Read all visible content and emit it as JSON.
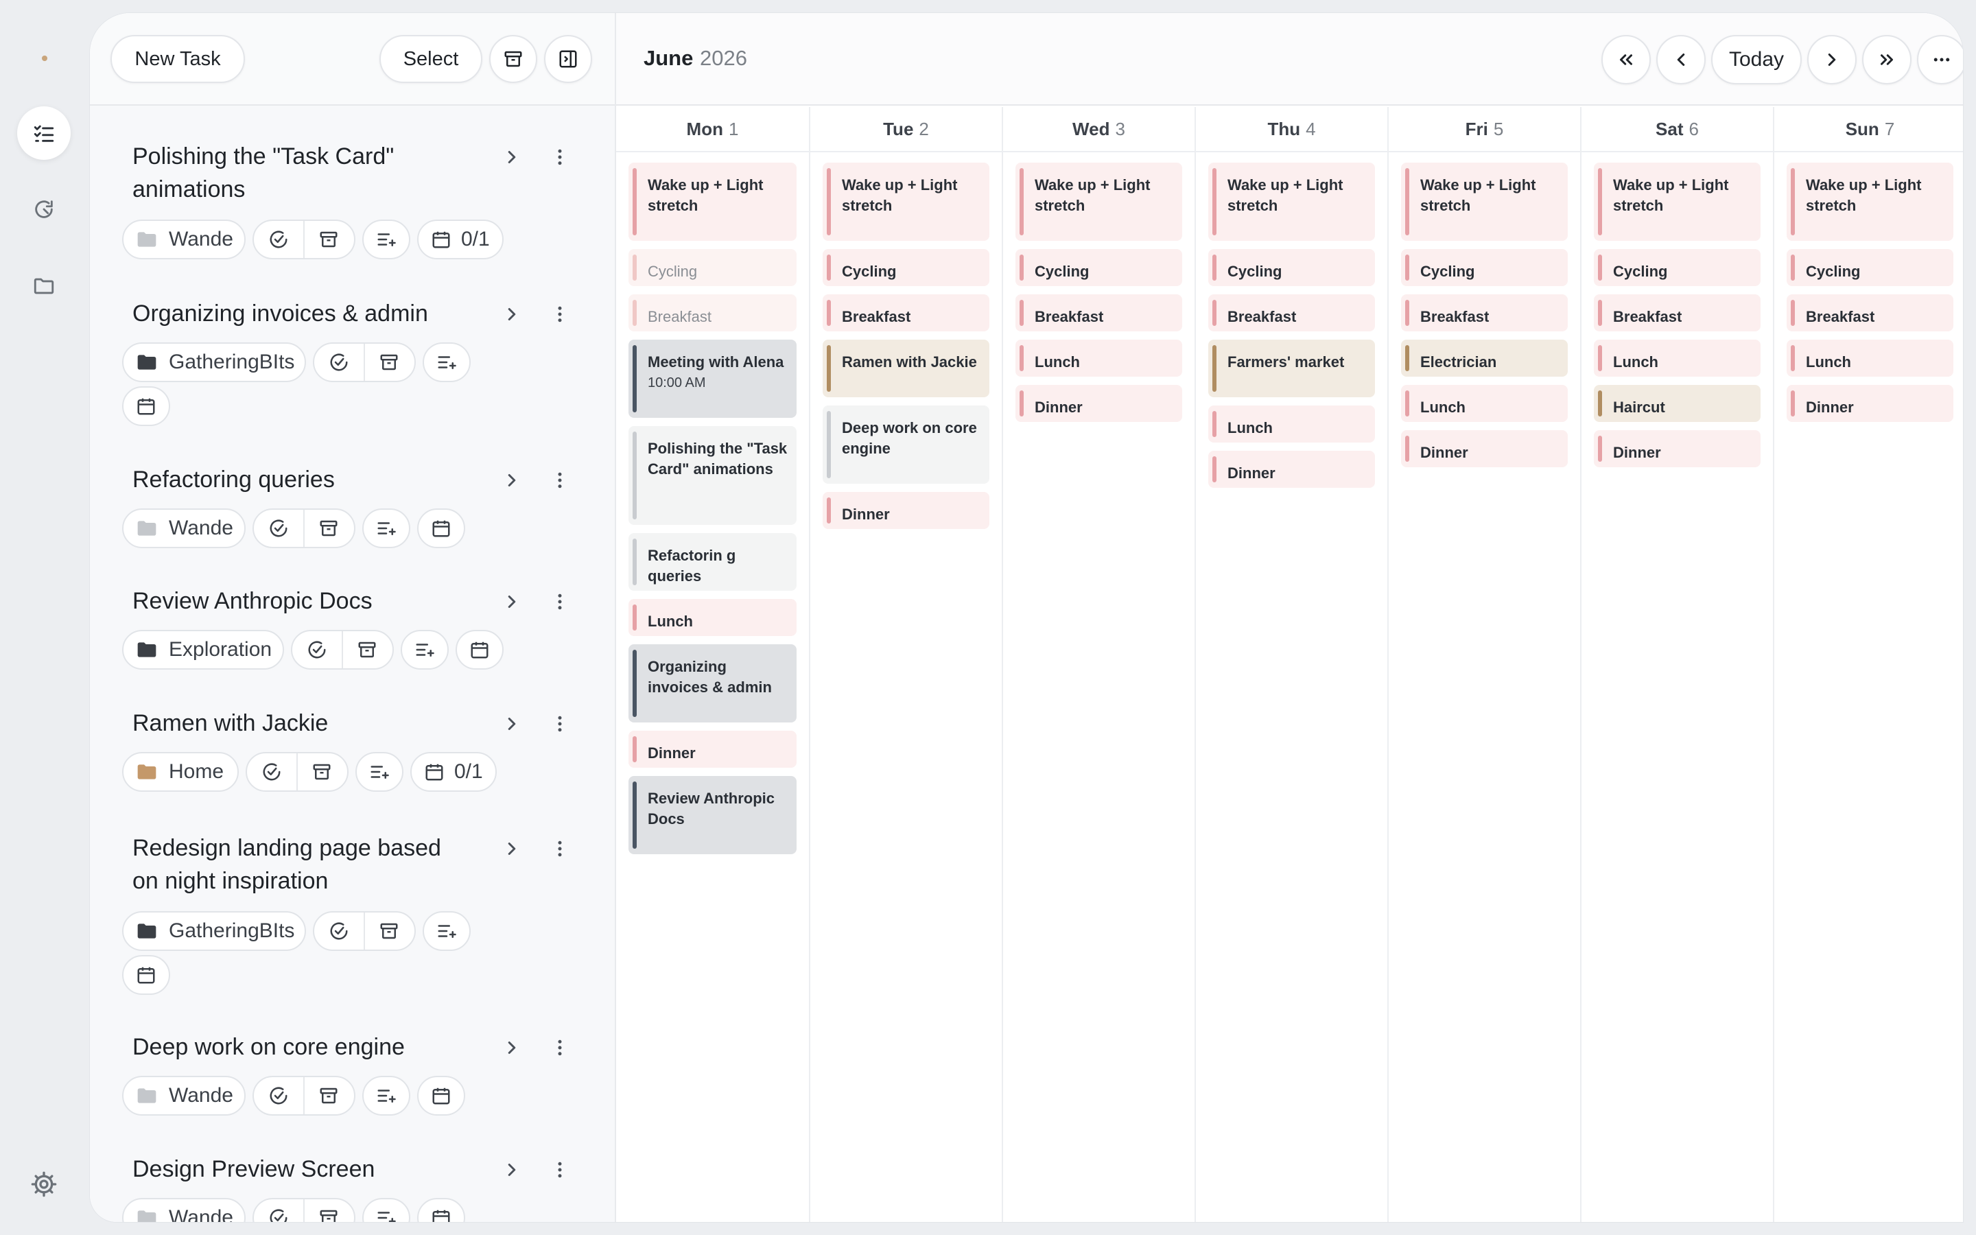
{
  "rail": {
    "items": [
      {
        "name": "tasks-icon",
        "active": true
      },
      {
        "name": "refresh-icon",
        "active": false
      },
      {
        "name": "folder-icon",
        "active": false
      }
    ]
  },
  "toolbar": {
    "new_task_label": "New Task",
    "select_label": "Select"
  },
  "tasks": [
    {
      "title": "Polishing the \"Task Card\" animations",
      "folder": "Wande",
      "folder_color": "#c4c7cb",
      "progress": "0/1"
    },
    {
      "title": "Organizing invoices & admin",
      "folder": "GatheringBIts",
      "folder_color": "#3b3f45",
      "progress": ""
    },
    {
      "title": "Refactoring queries",
      "folder": "Wande",
      "folder_color": "#c4c7cb",
      "progress": ""
    },
    {
      "title": "Review Anthropic Docs",
      "folder": "Exploration",
      "folder_color": "#3b3f45",
      "progress": ""
    },
    {
      "title": "Ramen with Jackie",
      "folder": "Home",
      "folder_color": "#c4986a",
      "progress": "0/1"
    },
    {
      "title": "Redesign landing page based on night inspiration",
      "folder": "GatheringBIts",
      "folder_color": "#3b3f45",
      "progress": ""
    },
    {
      "title": "Deep work on core engine",
      "folder": "Wande",
      "folder_color": "#c4c7cb",
      "progress": ""
    },
    {
      "title": "Design Preview Screen",
      "folder": "Wande",
      "folder_color": "#c4c7cb",
      "progress": ""
    }
  ],
  "calendar": {
    "month": "June",
    "year": "2026",
    "today_label": "Today",
    "days": [
      {
        "name": "Mon",
        "num": "1",
        "events": [
          {
            "title": "Wake up + Light stretch",
            "style": "pink"
          },
          {
            "title": "Cycling",
            "style": "pink-faded"
          },
          {
            "title": "Breakfast",
            "style": "pink-faded"
          },
          {
            "title": "Meeting with Alena",
            "time": "10:00 AM",
            "style": "gray"
          },
          {
            "title": "Polishing the \"Task Card\" animations",
            "style": "light"
          },
          {
            "title": "Refactorin g queries",
            "style": "light"
          },
          {
            "title": "Lunch",
            "style": "pink"
          },
          {
            "title": "Organizing invoices & admin",
            "style": "gray"
          },
          {
            "title": "Dinner",
            "style": "pink"
          },
          {
            "title": "Review Anthropic Docs",
            "style": "gray"
          }
        ]
      },
      {
        "name": "Tue",
        "num": "2",
        "events": [
          {
            "title": "Wake up + Light stretch",
            "style": "pink"
          },
          {
            "title": "Cycling",
            "style": "pink"
          },
          {
            "title": "Breakfast",
            "style": "pink"
          },
          {
            "title": "Ramen with Jackie",
            "style": "tan"
          },
          {
            "title": "Deep work on core engine",
            "style": "light"
          },
          {
            "title": "Dinner",
            "style": "pink"
          }
        ]
      },
      {
        "name": "Wed",
        "num": "3",
        "events": [
          {
            "title": "Wake up + Light stretch",
            "style": "pink"
          },
          {
            "title": "Cycling",
            "style": "pink"
          },
          {
            "title": "Breakfast",
            "style": "pink"
          },
          {
            "title": "Lunch",
            "style": "pink"
          },
          {
            "title": "Dinner",
            "style": "pink"
          }
        ]
      },
      {
        "name": "Thu",
        "num": "4",
        "events": [
          {
            "title": "Wake up + Light stretch",
            "style": "pink"
          },
          {
            "title": "Cycling",
            "style": "pink"
          },
          {
            "title": "Breakfast",
            "style": "pink"
          },
          {
            "title": "Farmers' market",
            "style": "tan"
          },
          {
            "title": "Lunch",
            "style": "pink"
          },
          {
            "title": "Dinner",
            "style": "pink"
          }
        ]
      },
      {
        "name": "Fri",
        "num": "5",
        "events": [
          {
            "title": "Wake up + Light stretch",
            "style": "pink"
          },
          {
            "title": "Cycling",
            "style": "pink"
          },
          {
            "title": "Breakfast",
            "style": "pink"
          },
          {
            "title": "Electrician",
            "style": "tan"
          },
          {
            "title": "Lunch",
            "style": "pink"
          },
          {
            "title": "Dinner",
            "style": "pink"
          }
        ]
      },
      {
        "name": "Sat",
        "num": "6",
        "events": [
          {
            "title": "Wake up + Light stretch",
            "style": "pink"
          },
          {
            "title": "Cycling",
            "style": "pink"
          },
          {
            "title": "Breakfast",
            "style": "pink"
          },
          {
            "title": "Lunch",
            "style": "pink"
          },
          {
            "title": "Haircut",
            "style": "tan"
          },
          {
            "title": "Dinner",
            "style": "pink"
          }
        ]
      },
      {
        "name": "Sun",
        "num": "7",
        "events": [
          {
            "title": "Wake up + Light stretch",
            "style": "pink"
          },
          {
            "title": "Cycling",
            "style": "pink"
          },
          {
            "title": "Breakfast",
            "style": "pink"
          },
          {
            "title": "Lunch",
            "style": "pink"
          },
          {
            "title": "Dinner",
            "style": "pink"
          }
        ]
      }
    ]
  }
}
